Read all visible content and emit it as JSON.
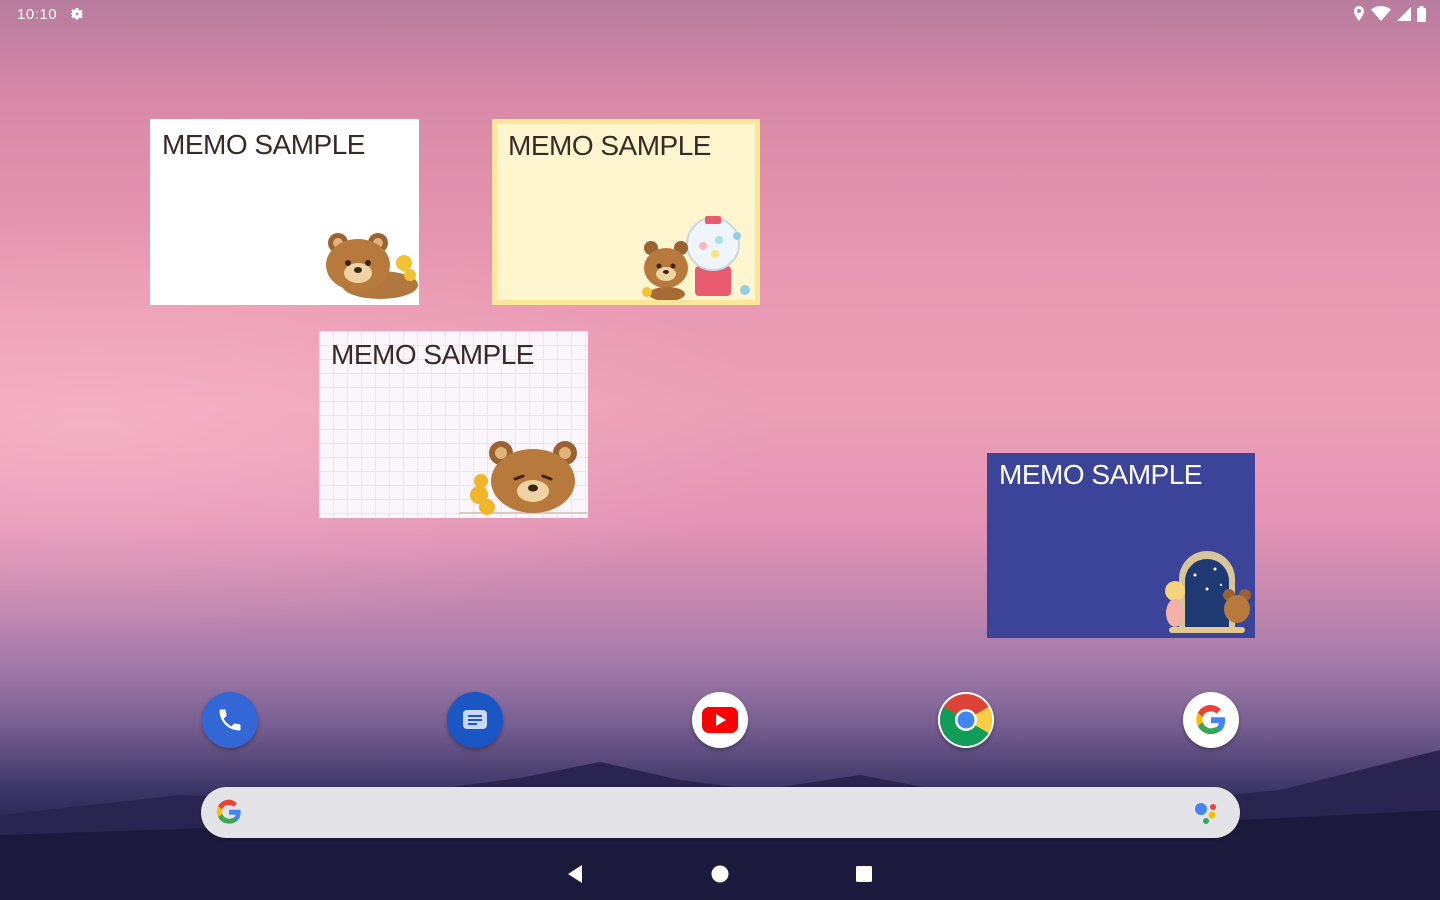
{
  "status_bar": {
    "time": "10:10",
    "icons": [
      "settings-gear-icon",
      "location-icon",
      "wifi-icon",
      "signal-icon",
      "battery-icon"
    ]
  },
  "widgets": [
    {
      "title": "MEMO SAMPLE",
      "style": "white",
      "art": "bear-lying-icon"
    },
    {
      "title": "MEMO SAMPLE",
      "style": "yellow",
      "art": "bear-candy-jar-icon"
    },
    {
      "title": "MEMO SAMPLE",
      "style": "grid-paper",
      "art": "bear-peeking-icon"
    },
    {
      "title": "MEMO SAMPLE",
      "style": "navy",
      "art": "bear-window-icon"
    }
  ],
  "dock": {
    "apps": [
      {
        "name": "Phone",
        "icon": "phone-icon",
        "color": "#3367d6"
      },
      {
        "name": "Messages",
        "icon": "messages-icon",
        "color": "#1a56c4"
      },
      {
        "name": "YouTube",
        "icon": "youtube-icon",
        "color": "#ff0000"
      },
      {
        "name": "Chrome",
        "icon": "chrome-icon",
        "color": "#ffffff"
      },
      {
        "name": "Google",
        "icon": "google-icon",
        "color": "#ffffff"
      }
    ]
  },
  "search_bar": {
    "left_icon": "google-g-icon",
    "right_icon": "assistant-icon"
  },
  "nav_bar": {
    "buttons": [
      "back-icon",
      "home-icon",
      "recents-icon"
    ]
  },
  "colors": {
    "memo_white": "#ffffff",
    "memo_yellow": "#fff6d0",
    "memo_yellow_border": "#fbe69a",
    "memo_grid": "#faf6fb",
    "memo_navy": "#3c449a"
  }
}
